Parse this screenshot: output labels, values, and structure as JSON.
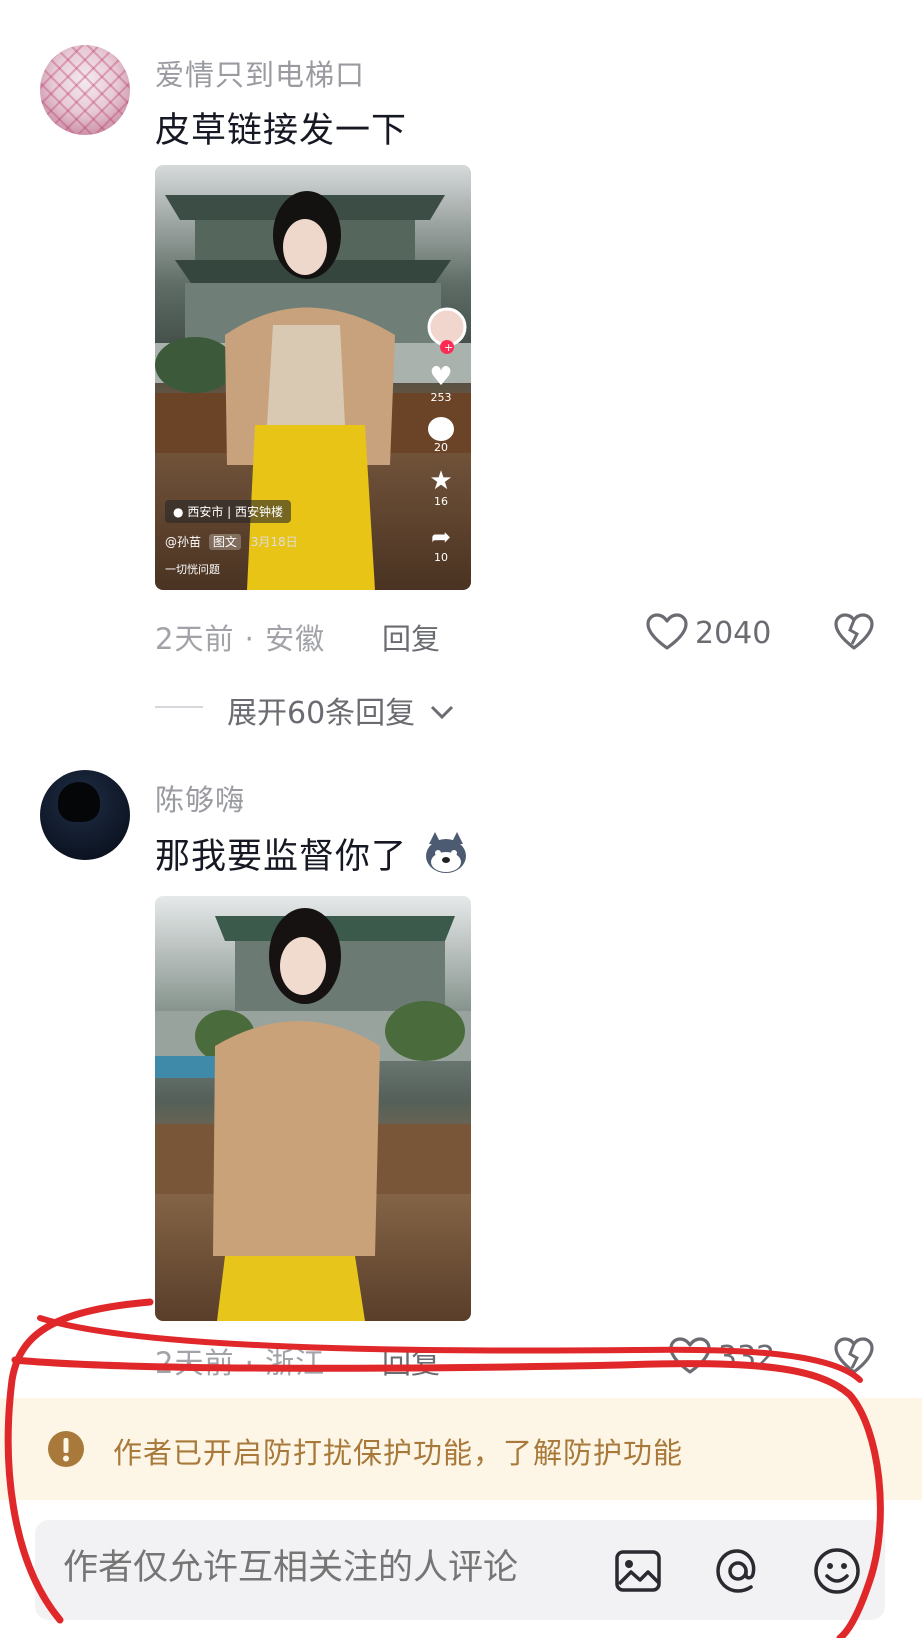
{
  "comments": [
    {
      "username": "爱情只到电梯口",
      "text": "皮草链接发一下",
      "meta": "2天前 · 安徽",
      "reply_label": "回复",
      "likes": "2040",
      "expand_label": "展开60条回复",
      "photo_overlay": {
        "location": "西安市 | 西安钟楼",
        "author": "@孙苗",
        "tag": "图文",
        "date": "3月18日",
        "caption": "一切恍问题",
        "stats": {
          "likes": "253",
          "comments": "20",
          "favorites": "16",
          "shares": "10"
        }
      }
    },
    {
      "username": "陈够嗨",
      "text": "那我要监督你了",
      "meta": "2天前 · 浙江",
      "reply_label": "回复",
      "likes": "332"
    }
  ],
  "notice": {
    "text": "作者已开启防打扰保护功能，了解防护功能"
  },
  "input": {
    "placeholder": "作者仅允许互相关注的人评论"
  },
  "colors": {
    "notice_bg": "#fdf6e6",
    "notice_text": "#a8793a",
    "annotation": "#e0282a"
  },
  "icons": [
    "warning-icon",
    "image-icon",
    "at-icon",
    "emoji-icon",
    "heart-icon",
    "broken-heart-icon",
    "chevron-down-icon"
  ]
}
